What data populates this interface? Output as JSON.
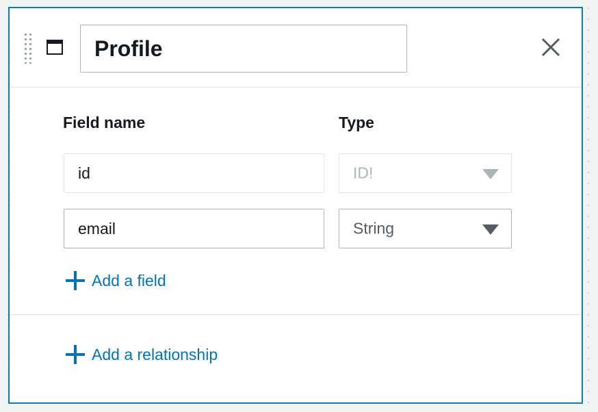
{
  "model": {
    "name": "Profile"
  },
  "fields_table": {
    "columns": {
      "name": "Field name",
      "type": "Type"
    },
    "rows": [
      {
        "name": "id",
        "type": "ID!",
        "locked": true
      },
      {
        "name": "email",
        "type": "String",
        "locked": false
      }
    ],
    "add_field_label": "Add a field"
  },
  "relationships": {
    "add_relationship_label": "Add a relationship"
  },
  "colors": {
    "accent_border": "#0a7fae",
    "link": "#0073bb",
    "text": "#16191f",
    "muted": "#aab7b8"
  },
  "icons": {
    "drag": "drag-handle-icon",
    "model": "window-icon",
    "close": "close-icon",
    "add": "plus-icon",
    "dropdown": "caret-down-icon"
  }
}
